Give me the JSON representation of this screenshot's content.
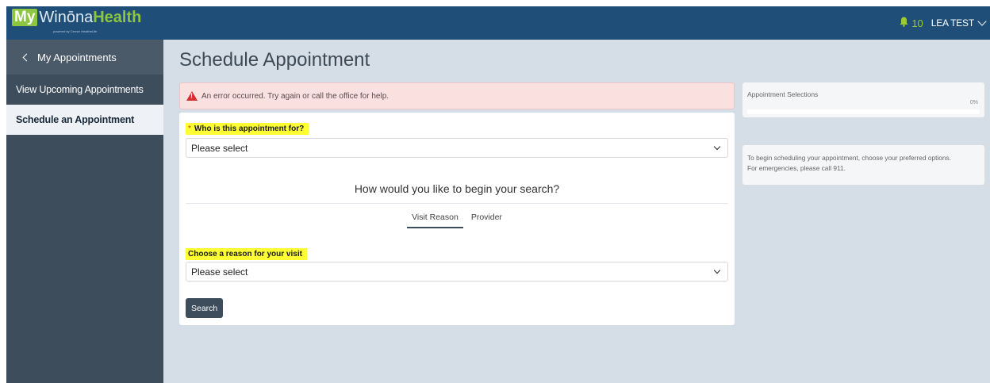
{
  "header": {
    "logo": {
      "my": "My",
      "winona": "Winōna",
      "health": "Health",
      "tagline": "powered by Cerner HealtheLife"
    },
    "notifications": {
      "icon": "bell-icon",
      "count": "10"
    },
    "user": {
      "name": "LEA TEST",
      "icon": "chevron-down-icon"
    }
  },
  "sidebar": {
    "back": {
      "label": "My Appointments",
      "icon": "chevron-left-icon"
    },
    "items": [
      {
        "label": "View Upcoming Appointments",
        "active": false
      },
      {
        "label": "Schedule an Appointment",
        "active": true
      }
    ]
  },
  "main": {
    "title": "Schedule Appointment",
    "alert": {
      "icon": "warning-icon",
      "text": "An error occurred. Try again or call the office for help."
    },
    "form": {
      "who_required_mark": "*",
      "who_label": "Who is this appointment for?",
      "who_value": "Please select",
      "question": "How would you like to begin your search?",
      "tabs": [
        {
          "label": "Visit Reason",
          "active": true
        },
        {
          "label": "Provider",
          "active": false
        }
      ],
      "reason_label": "Choose a reason for your visit",
      "reason_value": "Please select",
      "search_label": "Search"
    }
  },
  "right_panel": {
    "selections_title": "Appointment Selections",
    "progress_percent": "0%",
    "progress_value": 0,
    "info_line1": "To begin scheduling your appointment, choose your preferred options.",
    "info_line2": "For emergencies, please call 911."
  },
  "colors": {
    "header_bg": "#1f4e79",
    "sidebar_bg": "#3d4d5c",
    "accent_green": "#8dc63f",
    "highlight": "#ffff33",
    "error_bg": "#fbe0e0"
  }
}
